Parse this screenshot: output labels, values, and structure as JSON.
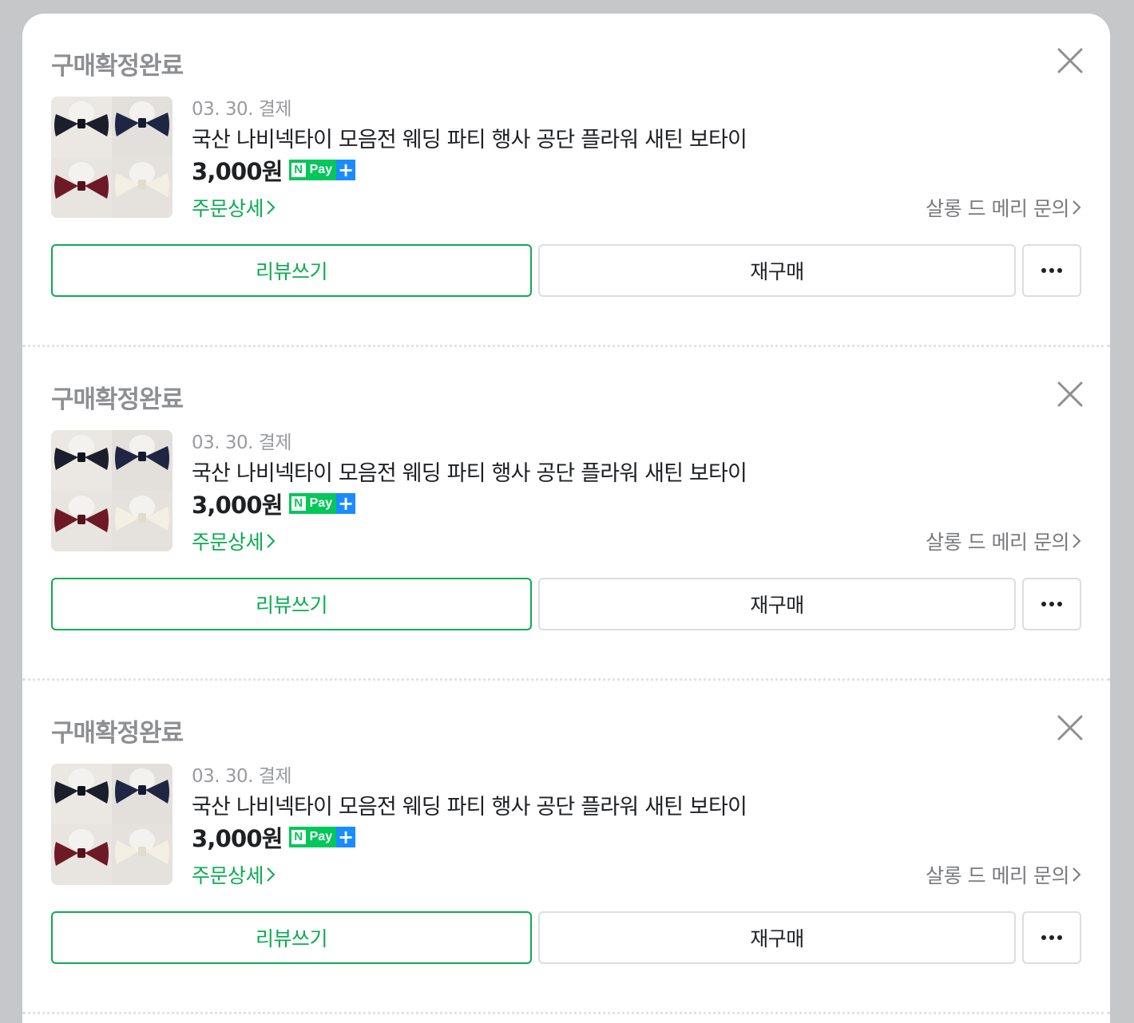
{
  "orders": [
    {
      "status": "구매확정완료",
      "date": "03. 30. 결제",
      "title": "국산 나비넥타이 모음전 웨딩 파티 행사 공단 플라워 새틴 보타이",
      "price": "3,000원",
      "npay_label": "Pay",
      "detail_link": "주문상세",
      "seller_link": "살롱 드 메리 문의",
      "review_button": "리뷰쓰기",
      "rebuy_button": "재구매",
      "more_button": "•••"
    },
    {
      "status": "구매확정완료",
      "date": "03. 30. 결제",
      "title": "국산 나비넥타이 모음전 웨딩 파티 행사 공단 플라워 새틴 보타이",
      "price": "3,000원",
      "npay_label": "Pay",
      "detail_link": "주문상세",
      "seller_link": "살롱 드 메리 문의",
      "review_button": "리뷰쓰기",
      "rebuy_button": "재구매",
      "more_button": "•••"
    },
    {
      "status": "구매확정완료",
      "date": "03. 30. 결제",
      "title": "국산 나비넥타이 모음전 웨딩 파티 행사 공단 플라워 새틴 보타이",
      "price": "3,000원",
      "npay_label": "Pay",
      "detail_link": "주문상세",
      "seller_link": "살롱 드 메리 문의",
      "review_button": "리뷰쓰기",
      "rebuy_button": "재구매",
      "more_button": "•••"
    }
  ],
  "icons": {
    "close": "close-icon",
    "chevron": "chevron-right-icon",
    "npay": "naver-pay-plus-badge",
    "thumbnail": "bow-tie-product-image"
  },
  "colors": {
    "green": "#0bac52",
    "npay_green": "#03c75a",
    "npay_blue": "#1a8cff",
    "status_gray": "#8e8f92",
    "background": "#c6c7c9"
  }
}
